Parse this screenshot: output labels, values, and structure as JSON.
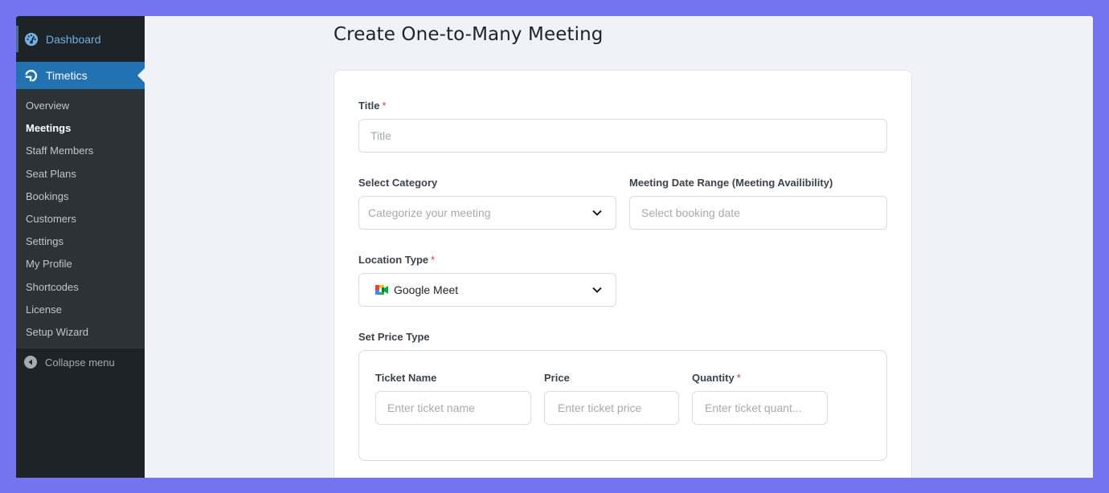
{
  "sidebar": {
    "dashboard": "Dashboard",
    "plugin": "Timetics",
    "items": [
      {
        "label": "Overview",
        "current": false
      },
      {
        "label": "Meetings",
        "current": true
      },
      {
        "label": "Staff Members",
        "current": false
      },
      {
        "label": "Seat Plans",
        "current": false
      },
      {
        "label": "Bookings",
        "current": false
      },
      {
        "label": "Customers",
        "current": false
      },
      {
        "label": "Settings",
        "current": false
      },
      {
        "label": "My Profile",
        "current": false
      },
      {
        "label": "Shortcodes",
        "current": false
      },
      {
        "label": "License",
        "current": false
      },
      {
        "label": "Setup Wizard",
        "current": false
      }
    ],
    "collapse": "Collapse menu"
  },
  "page": {
    "title": "Create One-to-Many Meeting"
  },
  "form": {
    "title_label": "Title",
    "title_placeholder": "Title",
    "category_label": "Select Category",
    "category_placeholder": "Categorize your meeting",
    "date_label": "Meeting Date Range (Meeting Availibility)",
    "date_placeholder": "Select booking date",
    "location_label": "Location Type",
    "location_value": "Google Meet",
    "price_type_label": "Set Price Type",
    "ticket_name_label": "Ticket Name",
    "ticket_name_placeholder": "Enter ticket name",
    "price_label": "Price",
    "price_placeholder": "Enter ticket price",
    "quantity_label": "Quantity",
    "quantity_placeholder": "Enter ticket quant...",
    "required_mark": "*"
  },
  "colors": {
    "frame": "#7473f0",
    "accent": "#2271b1",
    "required": "#d63638"
  }
}
